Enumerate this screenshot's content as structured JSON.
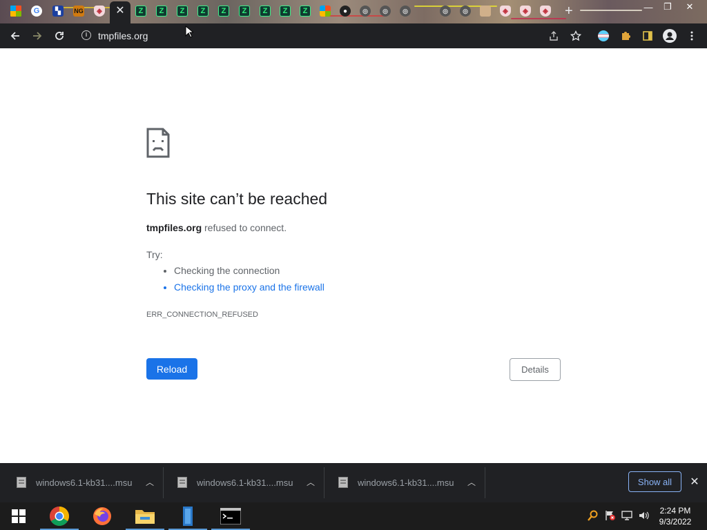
{
  "browser": {
    "url": "tmpfiles.org",
    "tabs": [
      {
        "icon": "windows-logo-icon"
      },
      {
        "icon": "google-icon"
      },
      {
        "icon": "blue-site-icon"
      },
      {
        "icon": "ng-site-icon"
      },
      {
        "icon": "shield-icon"
      },
      {
        "icon": "close-icon",
        "active": true
      },
      {
        "icon": "z-site-icon"
      },
      {
        "icon": "z-site-icon"
      },
      {
        "icon": "z-site-icon"
      },
      {
        "icon": "z-site-icon"
      },
      {
        "icon": "z-site-icon"
      },
      {
        "icon": "z-site-icon"
      },
      {
        "icon": "z-site-icon"
      },
      {
        "icon": "z-site-icon"
      },
      {
        "icon": "microsoft-icon"
      },
      {
        "icon": "github-icon"
      },
      {
        "icon": "grey-site-icon"
      },
      {
        "icon": "grey-site-icon"
      },
      {
        "icon": "grey-site-icon"
      },
      {
        "icon": "grey-site-icon"
      },
      {
        "icon": "grey-site-icon"
      },
      {
        "icon": "picture-site-icon"
      },
      {
        "icon": "shield-icon"
      },
      {
        "icon": "shield-icon"
      },
      {
        "icon": "shield-icon"
      }
    ]
  },
  "error_page": {
    "title": "This site can’t be reached",
    "host": "tmpfiles.org",
    "message_suffix": " refused to connect.",
    "try_label": "Try:",
    "suggestions": [
      {
        "text": "Checking the connection",
        "link": false
      },
      {
        "text": "Checking the proxy and the firewall",
        "link": true
      }
    ],
    "error_code": "ERR_CONNECTION_REFUSED",
    "reload_label": "Reload",
    "details_label": "Details"
  },
  "downloads": {
    "items": [
      {
        "name": "windows6.1-kb31....msu"
      },
      {
        "name": "windows6.1-kb31....msu"
      },
      {
        "name": "windows6.1-kb31....msu"
      }
    ],
    "show_all_label": "Show all"
  },
  "taskbar": {
    "apps": [
      "start-button",
      "chrome-icon",
      "firefox-icon",
      "file-explorer-icon",
      "notepad-icon",
      "command-prompt-icon"
    ],
    "time": "2:24 PM",
    "date": "9/3/2022"
  },
  "colors": {
    "accent": "#1a73e8",
    "toolbar": "#202124",
    "taskbar": "#1c1c1c"
  }
}
